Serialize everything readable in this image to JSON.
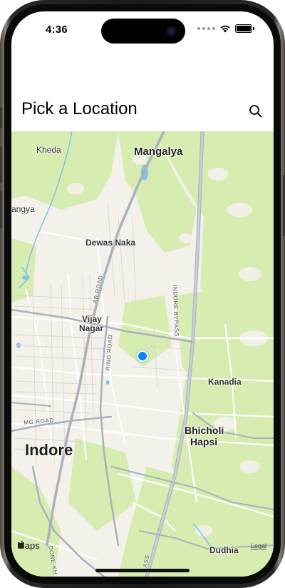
{
  "status_bar": {
    "time": "4:36"
  },
  "header": {
    "title": "Pick a Location"
  },
  "map": {
    "places": [
      {
        "name": "Mangalya"
      },
      {
        "name": "Dewas Naka"
      },
      {
        "name": "Vijay"
      },
      {
        "name": "Nagar"
      },
      {
        "name": "Kanadia"
      },
      {
        "name": "Bhicholi"
      },
      {
        "name": "Hapsi"
      },
      {
        "name": "Indore"
      },
      {
        "name": "Dudhia"
      },
      {
        "name": "Kheda"
      },
      {
        "name": "angya"
      }
    ],
    "roads": [
      {
        "name": "INDORE BYPASS"
      },
      {
        "name": "AB ROAD"
      },
      {
        "name": "RING ROAD"
      },
      {
        "name": "MG ROAD"
      },
      {
        "name": "DORE-KH"
      },
      {
        "name": "ASS"
      }
    ],
    "attribution": "Maps",
    "legal": "Legal"
  },
  "colors": {
    "park": "#d6ecb1",
    "road_major": "#a9b1bd",
    "road_minor": "#ffffff",
    "water": "#7ec3ea",
    "location_dot": "#0a84ff"
  }
}
